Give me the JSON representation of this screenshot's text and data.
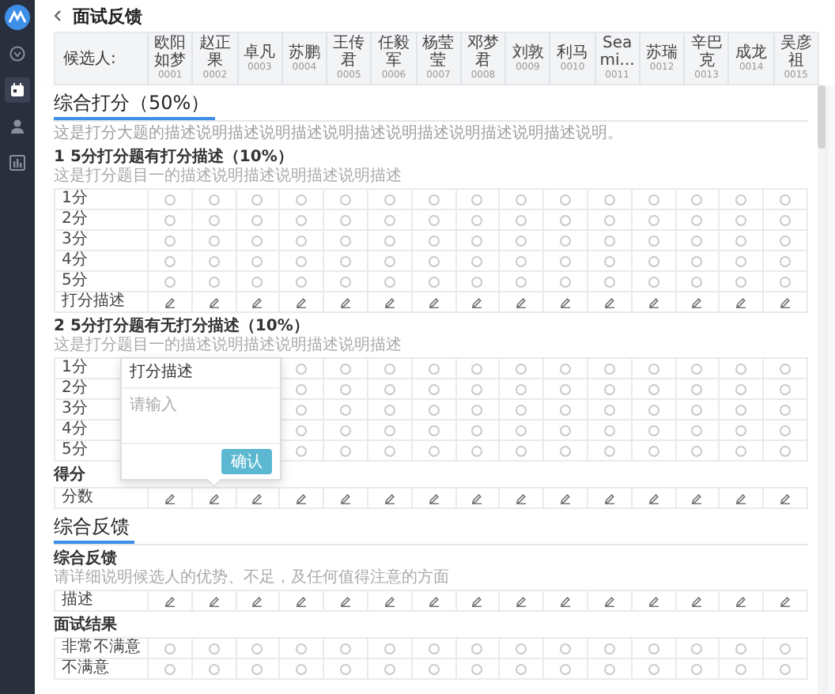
{
  "sidebar": {
    "items": [
      {
        "kind": "logo",
        "selected": false
      },
      {
        "kind": "filter",
        "selected": false
      },
      {
        "kind": "calendar",
        "selected": true
      },
      {
        "kind": "person",
        "selected": false
      },
      {
        "kind": "chart",
        "selected": false
      }
    ]
  },
  "header": {
    "title": "面试反馈"
  },
  "candidates": {
    "label": "候选人:",
    "items": [
      {
        "name": "欧阳如梦",
        "id": "0001"
      },
      {
        "name": "赵正果",
        "id": "0002"
      },
      {
        "name": "卓凡",
        "id": "0003"
      },
      {
        "name": "苏鹏",
        "id": "0004"
      },
      {
        "name": "王传君",
        "id": "0005"
      },
      {
        "name": "任毅军",
        "id": "0006"
      },
      {
        "name": "杨莹莹",
        "id": "0007"
      },
      {
        "name": "邓梦君",
        "id": "0008"
      },
      {
        "name": "刘敦",
        "id": "0009"
      },
      {
        "name": "利马",
        "id": "0010"
      },
      {
        "name": "Seami...",
        "id": "0011"
      },
      {
        "name": "苏瑞",
        "id": "0012"
      },
      {
        "name": "辛巴克",
        "id": "0013"
      },
      {
        "name": "成龙",
        "id": "0014"
      },
      {
        "name": "吴彦祖",
        "id": "0015"
      }
    ]
  },
  "sections": [
    {
      "title": "综合打分（50%）",
      "description": "这是打分大题的描述说明描述说明描述说明描述说明描述说明描述说明描述说明。",
      "questions": [
        {
          "title": "1 5分打分题有打分描述（10%）",
          "description": "这是打分题目一的描述说明描述说明描述说明描述",
          "rows": [
            {
              "kind": "radio",
              "label": "1分",
              "cells": [
                {
                  "checked": false
                },
                {
                  "checked": false
                },
                {
                  "checked": false
                },
                {
                  "checked": false
                },
                {
                  "checked": false
                },
                {
                  "checked": false
                },
                {
                  "checked": false
                },
                {
                  "checked": false
                },
                {
                  "checked": false
                },
                {
                  "checked": false
                },
                {
                  "checked": false
                },
                {
                  "checked": false
                },
                {
                  "checked": false
                },
                {
                  "checked": false
                },
                {
                  "checked": false
                }
              ]
            },
            {
              "kind": "radio",
              "label": "2分",
              "cells": [
                {
                  "checked": false
                },
                {
                  "checked": false
                },
                {
                  "checked": false
                },
                {
                  "checked": false
                },
                {
                  "checked": false
                },
                {
                  "checked": false
                },
                {
                  "checked": false
                },
                {
                  "checked": false
                },
                {
                  "checked": false
                },
                {
                  "checked": false
                },
                {
                  "checked": false
                },
                {
                  "checked": false
                },
                {
                  "checked": false
                },
                {
                  "checked": false
                },
                {
                  "checked": false
                }
              ]
            },
            {
              "kind": "radio",
              "label": "3分",
              "cells": [
                {
                  "checked": false
                },
                {
                  "checked": false
                },
                {
                  "checked": false
                },
                {
                  "checked": false
                },
                {
                  "checked": false
                },
                {
                  "checked": false
                },
                {
                  "checked": false
                },
                {
                  "checked": false
                },
                {
                  "checked": false
                },
                {
                  "checked": false
                },
                {
                  "checked": false
                },
                {
                  "checked": false
                },
                {
                  "checked": false
                },
                {
                  "checked": false
                },
                {
                  "checked": false
                }
              ]
            },
            {
              "kind": "radio",
              "label": "4分",
              "cells": [
                {
                  "checked": false
                },
                {
                  "checked": false
                },
                {
                  "checked": false
                },
                {
                  "checked": false
                },
                {
                  "checked": false
                },
                {
                  "checked": false
                },
                {
                  "checked": false
                },
                {
                  "checked": false
                },
                {
                  "checked": false
                },
                {
                  "checked": false
                },
                {
                  "checked": false
                },
                {
                  "checked": false
                },
                {
                  "checked": false
                },
                {
                  "checked": false
                },
                {
                  "checked": false
                }
              ]
            },
            {
              "kind": "radio",
              "label": "5分",
              "cells": [
                {
                  "checked": false
                },
                {
                  "checked": false
                },
                {
                  "checked": false
                },
                {
                  "checked": false
                },
                {
                  "checked": false
                },
                {
                  "checked": false
                },
                {
                  "checked": false
                },
                {
                  "checked": false
                },
                {
                  "checked": false
                },
                {
                  "checked": false
                },
                {
                  "checked": false
                },
                {
                  "checked": false
                },
                {
                  "checked": false
                },
                {
                  "checked": false
                },
                {
                  "checked": false
                }
              ]
            },
            {
              "kind": "edit",
              "label": "打分描述"
            }
          ]
        },
        {
          "title": "2 5分打分题有无打分描述（10%）",
          "description": "这是打分题目一的描述说明描述说明描述说明描述",
          "rows": [
            {
              "kind": "radio",
              "label": "1分",
              "cells": [
                null,
                null,
                null,
                {
                  "checked": false
                },
                {
                  "checked": false
                },
                {
                  "checked": false
                },
                {
                  "checked": false
                },
                {
                  "checked": false
                },
                {
                  "checked": false
                },
                {
                  "checked": false
                },
                {
                  "checked": false
                },
                {
                  "checked": false
                },
                {
                  "checked": false
                },
                {
                  "checked": false
                },
                {
                  "checked": false
                }
              ]
            },
            {
              "kind": "radio",
              "label": "2分",
              "cells": [
                null,
                null,
                null,
                {
                  "checked": false
                },
                {
                  "checked": false
                },
                {
                  "checked": false
                },
                {
                  "checked": false
                },
                {
                  "checked": false
                },
                {
                  "checked": false
                },
                {
                  "checked": false
                },
                {
                  "checked": false
                },
                {
                  "checked": false
                },
                {
                  "checked": false
                },
                {
                  "checked": false
                },
                {
                  "checked": false
                }
              ]
            },
            {
              "kind": "radio",
              "label": "3分",
              "cells": [
                null,
                null,
                null,
                {
                  "checked": false
                },
                {
                  "checked": false
                },
                {
                  "checked": false
                },
                {
                  "checked": false
                },
                {
                  "checked": false
                },
                {
                  "checked": false
                },
                {
                  "checked": false
                },
                {
                  "checked": false
                },
                {
                  "checked": false
                },
                {
                  "checked": false
                },
                {
                  "checked": false
                },
                {
                  "checked": false
                }
              ]
            },
            {
              "kind": "radio",
              "label": "4分",
              "cells": [
                null,
                null,
                null,
                {
                  "checked": false
                },
                {
                  "checked": false
                },
                {
                  "checked": false
                },
                {
                  "checked": false
                },
                {
                  "checked": false
                },
                {
                  "checked": false
                },
                {
                  "checked": false
                },
                {
                  "checked": false
                },
                {
                  "checked": false
                },
                {
                  "checked": false
                },
                {
                  "checked": false
                },
                {
                  "checked": false
                }
              ]
            },
            {
              "kind": "radio",
              "label": "5分",
              "cells": [
                null,
                null,
                null,
                {
                  "checked": false
                },
                {
                  "checked": false
                },
                {
                  "checked": false
                },
                {
                  "checked": false
                },
                {
                  "checked": false
                },
                {
                  "checked": false
                },
                {
                  "checked": false
                },
                {
                  "checked": false
                },
                {
                  "checked": false
                },
                {
                  "checked": false
                },
                {
                  "checked": false
                },
                {
                  "checked": false
                }
              ]
            }
          ]
        },
        {
          "title": "得分",
          "rows": [
            {
              "kind": "edit",
              "label": "分数",
              "popover": {
                "title": "打分描述",
                "placeholder": "请输入",
                "button": "确认"
              }
            }
          ]
        }
      ]
    },
    {
      "title": "综合反馈",
      "questions": [
        {
          "title": "综合反馈",
          "description": "请详细说明候选人的优势、不足，及任何值得注意的方面",
          "rows": [
            {
              "kind": "edit",
              "label": "描述"
            }
          ]
        },
        {
          "title": "面试结果",
          "rows": [
            {
              "kind": "radio",
              "label": "非常不满意",
              "cells": [
                {
                  "checked": false
                },
                {
                  "checked": false
                },
                {
                  "checked": false
                },
                {
                  "checked": false
                },
                {
                  "checked": false
                },
                {
                  "checked": false
                },
                {
                  "checked": false
                },
                {
                  "checked": false
                },
                {
                  "checked": false
                },
                {
                  "checked": false
                },
                {
                  "checked": false
                },
                {
                  "checked": false
                },
                {
                  "checked": false
                },
                {
                  "checked": false
                },
                {
                  "checked": false
                }
              ]
            },
            {
              "kind": "radio",
              "label": "不满意",
              "cells": [
                {
                  "checked": false
                },
                {
                  "checked": false
                },
                {
                  "checked": false
                },
                {
                  "checked": false
                },
                {
                  "checked": false
                },
                {
                  "checked": false
                },
                {
                  "checked": false
                },
                {
                  "checked": false
                },
                {
                  "checked": false
                },
                {
                  "checked": false
                },
                {
                  "checked": false
                },
                {
                  "checked": false
                },
                {
                  "checked": false
                },
                {
                  "checked": false
                },
                {
                  "checked": false
                }
              ]
            }
          ]
        }
      ]
    }
  ]
}
